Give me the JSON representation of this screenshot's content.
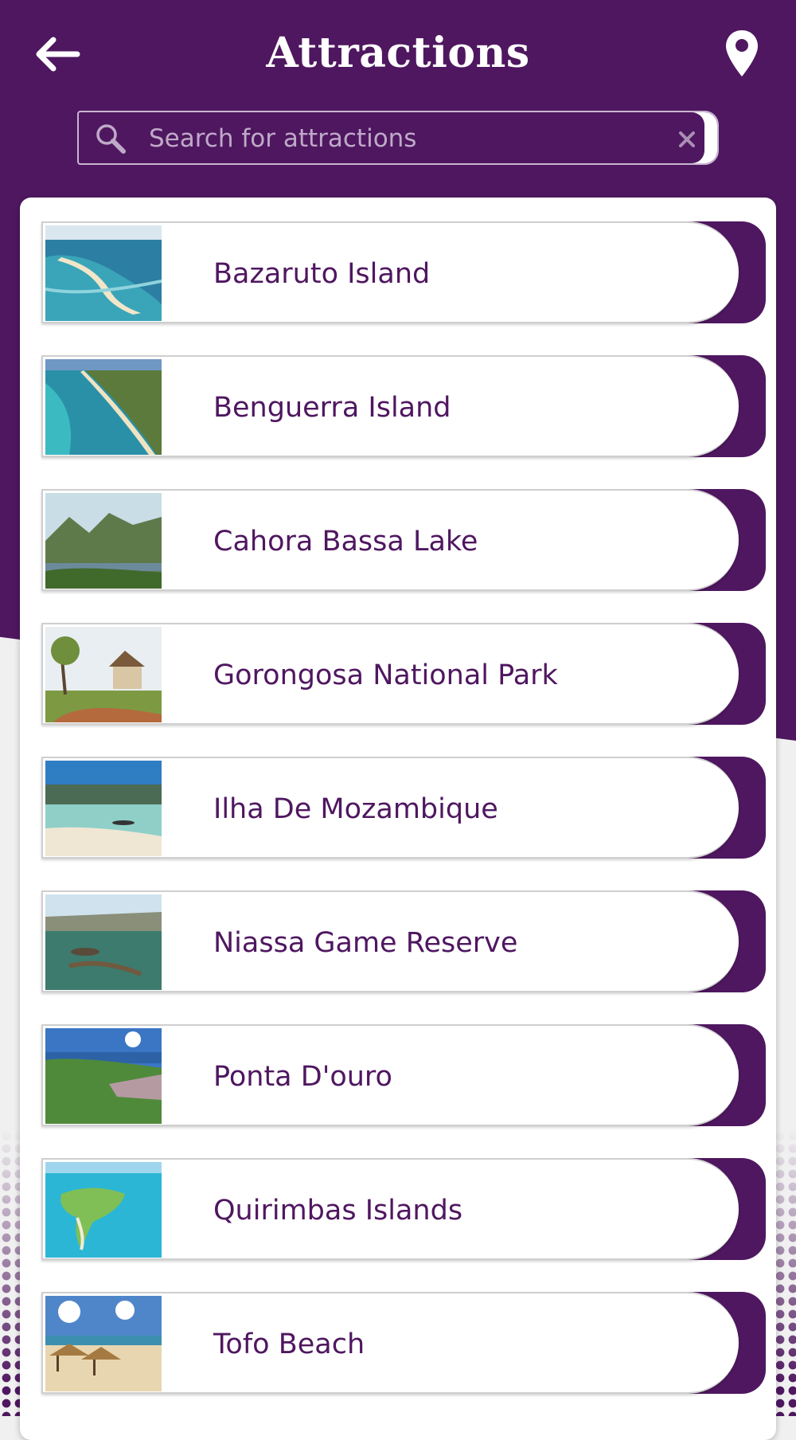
{
  "header": {
    "title": "Attractions",
    "back_icon": "arrow-left-icon",
    "location_icon": "map-pin-icon"
  },
  "search": {
    "placeholder": "Search for attractions",
    "value": "",
    "search_icon": "search-icon",
    "clear_icon": "close-icon"
  },
  "colors": {
    "brand_purple": "#4f1760",
    "label_purple": "#4f1760",
    "placeholder": "#bfa9c8",
    "card_background": "#ffffff"
  },
  "attractions": [
    {
      "name": "Bazaruto Island"
    },
    {
      "name": "Benguerra Island"
    },
    {
      "name": "Cahora Bassa Lake"
    },
    {
      "name": "Gorongosa National Park"
    },
    {
      "name": "Ilha De Mozambique"
    },
    {
      "name": "Niassa Game Reserve"
    },
    {
      "name": "Ponta D'ouro"
    },
    {
      "name": "Quirimbas Islands"
    },
    {
      "name": "Tofo Beach"
    }
  ]
}
